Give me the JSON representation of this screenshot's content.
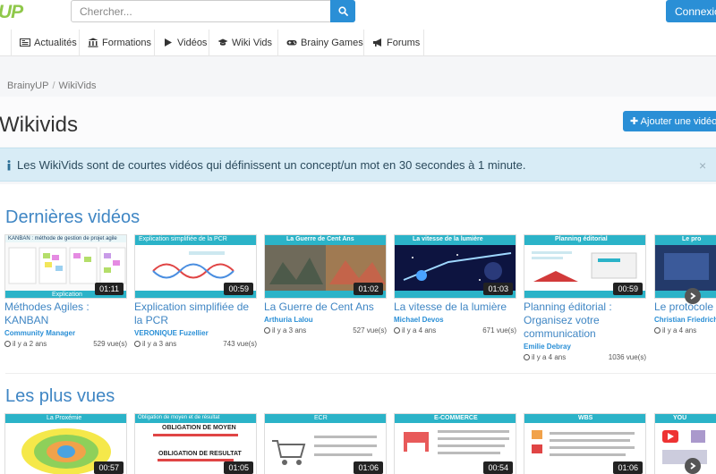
{
  "header": {
    "logo": "UP",
    "search_placeholder": "Chercher...",
    "login_label": "Connexion"
  },
  "nav": {
    "items": [
      {
        "label": "Actualités",
        "icon": "newspaper-icon"
      },
      {
        "label": "Formations",
        "icon": "institution-icon"
      },
      {
        "label": "Vidéos",
        "icon": "play-icon"
      },
      {
        "label": "Wiki Vids",
        "icon": "graduation-cap-icon"
      },
      {
        "label": "Brainy Games",
        "icon": "gamepad-icon"
      },
      {
        "label": "Forums",
        "icon": "bullhorn-icon"
      }
    ]
  },
  "breadcrumb": {
    "root": "BrainyUP",
    "separator": "/",
    "current": "WikiVids"
  },
  "page": {
    "title": "Wikivids",
    "add_button": "Ajouter une vidéo"
  },
  "alert": {
    "text": "Les WikiVids sont de courtes vidéos qui définissent un concept/un mot en 30 secondes à 1 minute.",
    "close": "×"
  },
  "latest": {
    "title": "Dernières vidéos",
    "videos": [
      {
        "title": "Méthodes Agiles : KANBAN",
        "author": "Community Manager",
        "age": "il y a 2 ans",
        "views": "529 vue(s)",
        "duration": "01:11",
        "thumb_caption": "KANBAN : méthode de gestion de projet agile",
        "thumb_footer": "Explication"
      },
      {
        "title": "Explication simplifiée de la PCR",
        "author": "VERONIQUE Fuzellier",
        "age": "il y a 3 ans",
        "views": "743 vue(s)",
        "duration": "00:59",
        "thumb_caption": "Explication simplifiée de la PCR"
      },
      {
        "title": "La Guerre de Cent Ans",
        "author": "Arthuria Lalou",
        "age": "il y a 3 ans",
        "views": "527 vue(s)",
        "duration": "01:02",
        "thumb_caption": "La Guerre de Cent Ans"
      },
      {
        "title": "La vitesse de la lumière",
        "author": "Michael Devos",
        "age": "il y a 4 ans",
        "views": "671 vue(s)",
        "duration": "01:03",
        "thumb_caption": "La vitesse de la lumière"
      },
      {
        "title": "Planning éditorial : Organisez votre communication",
        "author": "Emilie Debray",
        "age": "il y a 4 ans",
        "views": "1036 vue(s)",
        "duration": "00:59",
        "thumb_caption": "Planning éditorial"
      },
      {
        "title": "Le protocole",
        "author": "Christian Friedrich",
        "age": "il y a 4 ans",
        "views": "",
        "duration": "",
        "thumb_caption": "Le pro"
      }
    ]
  },
  "popular": {
    "title": "Les plus vues",
    "videos": [
      {
        "duration": "00:57",
        "thumb_caption": "La Proxémie"
      },
      {
        "duration": "01:05",
        "thumb_caption": "Obligation de moyen et de résultat",
        "thumb_line1": "OBLIGATION DE MOYEN",
        "thumb_line2": "OBLIGATION DE RESULTAT"
      },
      {
        "duration": "01:06",
        "thumb_caption": "ECR"
      },
      {
        "duration": "00:54",
        "thumb_caption": "E-COMMERCE"
      },
      {
        "duration": "01:06",
        "thumb_caption": "WBS"
      },
      {
        "duration": "",
        "thumb_caption": "YOU"
      }
    ]
  },
  "colors": {
    "primary": "#2a8fd6",
    "link": "#3f86c4",
    "logo_green": "#8fc84a",
    "alert_bg": "#d8ecf6",
    "thumb_teal": "#2bb3c8"
  }
}
